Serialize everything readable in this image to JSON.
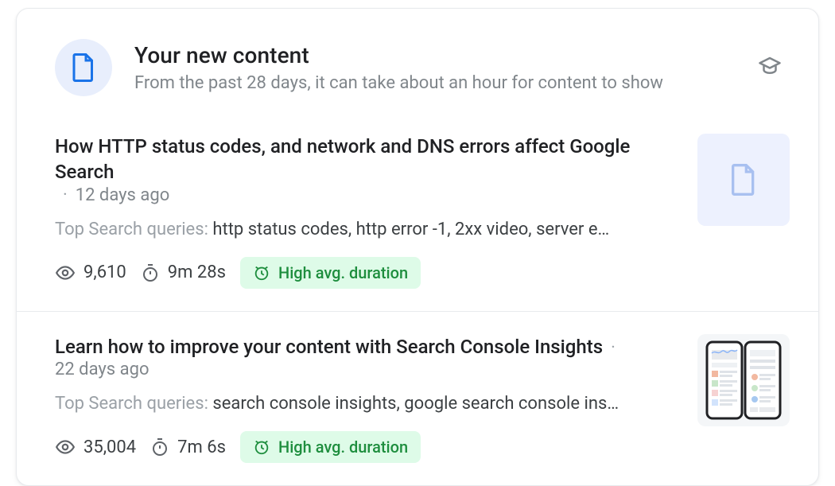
{
  "header": {
    "title": "Your new content",
    "subtitle": "From the past 28 days, it can take about an hour for content to show",
    "icon": "page-icon",
    "edu_tooltip": "Learn more"
  },
  "queries_label": "Top Search queries: ",
  "badge_text": "High avg. duration",
  "items": [
    {
      "title": "How HTTP status codes, and network and DNS errors affect Google Search",
      "age": "12 days ago",
      "queries": "http status codes, http error -1, 2xx video, server e…",
      "views": "9,610",
      "duration": "9m 28s",
      "thumb_kind": "page"
    },
    {
      "title": "Learn how to improve your content with Search Console Insights",
      "age": "22 days ago",
      "queries": "search console insights, google search console ins…",
      "views": "35,004",
      "duration": "7m 6s",
      "thumb_kind": "phones"
    }
  ]
}
